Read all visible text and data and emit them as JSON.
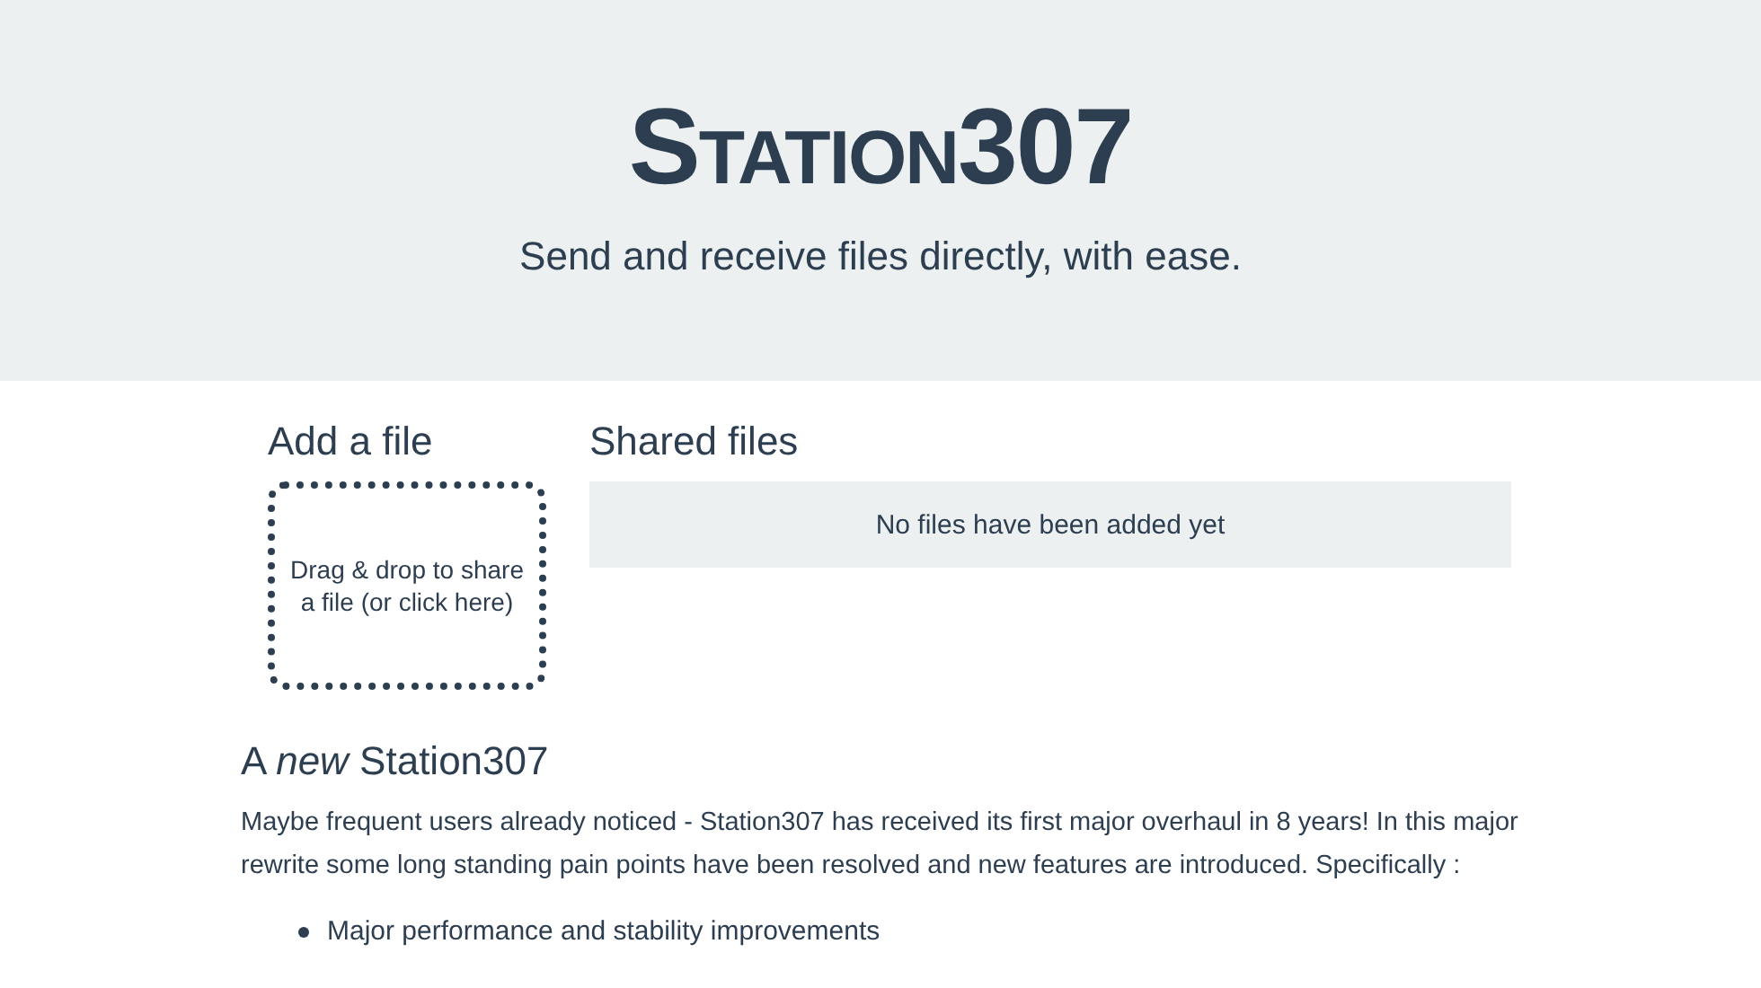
{
  "header": {
    "title": "Station307",
    "tagline": "Send and receive files directly, with ease."
  },
  "add_file": {
    "heading": "Add a file",
    "dropzone": "Drag & drop to share a file (or click here)"
  },
  "shared_files": {
    "heading": "Shared files",
    "empty_message": "No files have been added yet"
  },
  "news": {
    "heading": "A *new* Station307",
    "paragraph": "Maybe frequent users already noticed - Station307 has received its first major overhaul in 8 years! In this major rewrite some long standing pain points have been resolved and new features are introduced. Specifically :",
    "items": [
      "Major performance and stability improvements"
    ]
  }
}
